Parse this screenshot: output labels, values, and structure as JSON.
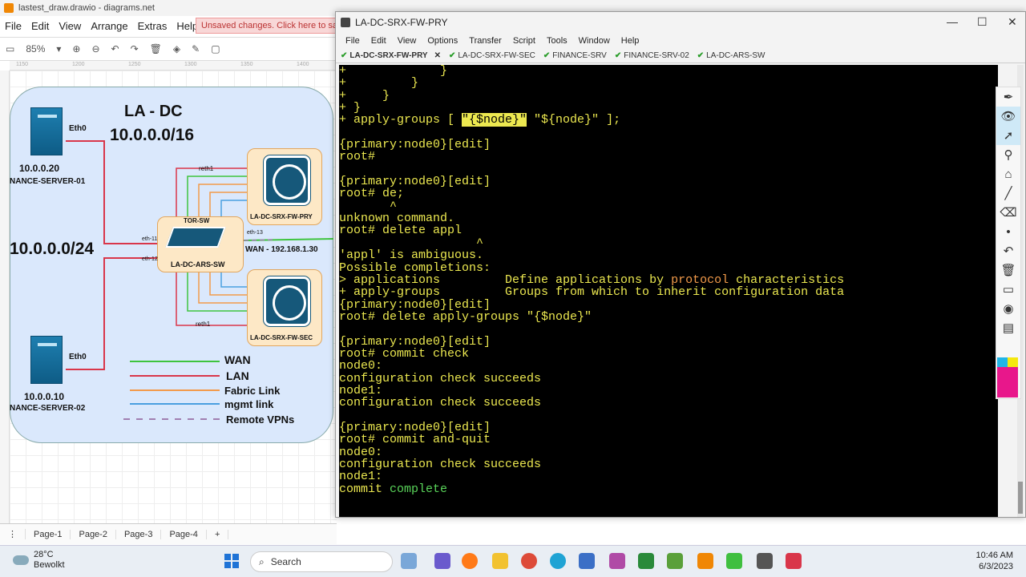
{
  "drawio": {
    "window_title": "lastest_draw.drawio - diagrams.net",
    "menu": [
      "File",
      "Edit",
      "View",
      "Arrange",
      "Extras",
      "Help"
    ],
    "unsaved": "Unsaved changes. Click here to save.",
    "zoom": "85%",
    "ruler_marks": [
      "1150",
      "1200",
      "1250",
      "1300",
      "1350",
      "1400"
    ],
    "pages": [
      "Page-1",
      "Page-2",
      "Page-3",
      "Page-4"
    ],
    "diagram": {
      "dc_title": "LA - DC",
      "dc_subnet": "10.0.0.0/16",
      "lan_subnet": "10.0.0.0/24",
      "server1_ip": "10.0.0.20",
      "server1_name": "NANCE-SERVER-01",
      "server1_if": "Eth0",
      "server2_ip": "10.0.0.10",
      "server2_name": "NANCE-SERVER-02",
      "server2_if": "Eth0",
      "fw_pry": "LA-DC-SRX-FW-PRY",
      "fw_sec": "LA-DC-SRX-FW-SEC",
      "tor_label": "TOR-SW",
      "tor_name": "LA-DC-ARS-SW",
      "wan": "WAN - 192.168.1.30",
      "reth_top": "reth1",
      "reth_bottom": "reth1",
      "eth11": "eth-11",
      "eth12": "eth-12",
      "eth13": "eth-13",
      "legend": [
        "WAN",
        "LAN",
        "Fabric Link",
        "mgmt link",
        "Remote VPNs"
      ],
      "legend_colors": [
        "#3ec43e",
        "#d9364a",
        "#f29a4a",
        "#4a9fe0",
        "#a07fb0"
      ]
    }
  },
  "terminal": {
    "title": "LA-DC-SRX-FW-PRY",
    "menu": [
      "File",
      "Edit",
      "View",
      "Options",
      "Transfer",
      "Script",
      "Tools",
      "Window",
      "Help"
    ],
    "tabs": [
      "LA-DC-SRX-FW-PRY",
      "LA-DC-SRX-FW-SEC",
      "FINANCE-SRV",
      "FINANCE-SRV-02",
      "LA-DC-ARS-SW"
    ],
    "lines": [
      "+             }",
      "+         }",
      "+     }",
      "+ }",
      "+ apply-groups [ \"{$node}\" \"${node}\" ];",
      "",
      "{primary:node0}[edit]",
      "root#",
      "",
      "{primary:node0}[edit]",
      "root# de;",
      "       ^",
      "unknown command.",
      "root# delete appl",
      "                   ^",
      "'appl' is ambiguous.",
      "Possible completions:",
      "> applications         Define applications by protocol characteristics",
      "+ apply-groups         Groups from which to inherit configuration data",
      "{primary:node0}[edit]",
      "root# delete apply-groups \"{$node}\"",
      "",
      "{primary:node0}[edit]",
      "root# commit check",
      "node0:",
      "configuration check succeeds",
      "node1:",
      "configuration check succeeds",
      "",
      "{primary:node0}[edit]",
      "root# commit and-quit",
      "node0:",
      "configuration check succeeds",
      "node1:",
      "commit complete"
    ],
    "accent": "#ece850"
  },
  "taskbar": {
    "temp": "28°C",
    "weather": "Bewolkt",
    "search": "Search",
    "time": "10:46 AM",
    "date": "6/3/2023"
  }
}
